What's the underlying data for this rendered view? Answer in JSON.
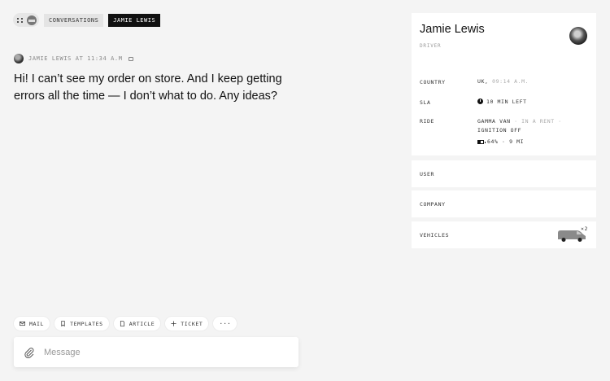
{
  "header": {
    "logo_icon": "apps-grid-icon",
    "breadcrumbs": [
      {
        "label": "CONVERSATIONS",
        "active": false
      },
      {
        "label": "JAMIE LEWIS",
        "active": true
      }
    ]
  },
  "message": {
    "author_meta": "JAMIE LEWIS AT 11:34 A.M",
    "body": "Hi! I can’t see my order on store. And I keep getting errors all the time — I don’t what to do. Any ideas?"
  },
  "actions": [
    {
      "label": "MAIL",
      "icon": "mail-icon"
    },
    {
      "label": "TEMPLATES",
      "icon": "bookmark-icon"
    },
    {
      "label": "ARTICLE",
      "icon": "document-icon"
    },
    {
      "label": "TICKET",
      "icon": "plus-icon"
    },
    {
      "label": "···",
      "icon": "more-icon"
    }
  ],
  "composer": {
    "placeholder": "Message",
    "attach_icon": "paperclip-icon"
  },
  "profile": {
    "name": "Jamie Lewis",
    "role": "DRIVER",
    "country_label": "COUNTRY",
    "country_value": "UK,",
    "country_time": "09:14 A.M.",
    "sla_label": "SLA",
    "sla_value": "10 MIN LEFT",
    "ride_label": "RIDE",
    "ride_vehicle": "GAMMA VAN",
    "ride_status": " · IN A RENT · ",
    "ride_state": "IGNITION OFF",
    "battery": "64% · 9 MI"
  },
  "sections": {
    "user": "USER",
    "company": "COMPANY",
    "vehicles": "VEHICLES",
    "vehicles_count": "×2"
  },
  "colors": {
    "background": "#f4f4f4",
    "active_crumb": "#111111",
    "card": "#ffffff"
  }
}
